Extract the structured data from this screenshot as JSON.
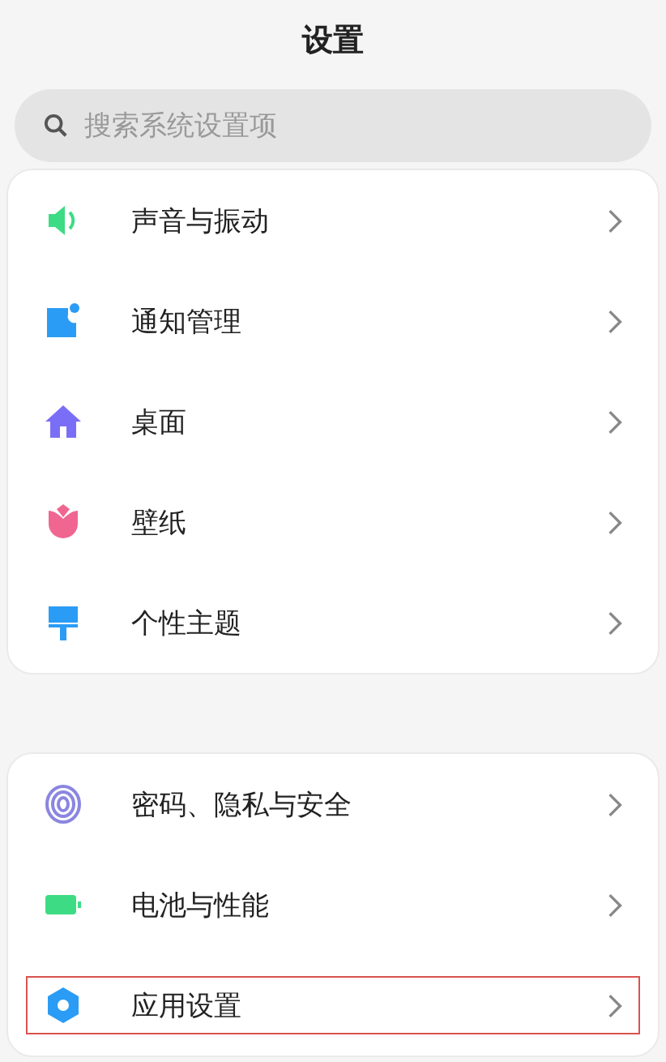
{
  "title": "设置",
  "search": {
    "placeholder": "搜索系统设置项"
  },
  "groups": [
    {
      "items": [
        {
          "label": "声音与振动",
          "highlighted": false
        },
        {
          "label": "通知管理",
          "highlighted": false
        },
        {
          "label": "桌面",
          "highlighted": false
        },
        {
          "label": "壁纸",
          "highlighted": false
        },
        {
          "label": "个性主题",
          "highlighted": false
        }
      ]
    },
    {
      "items": [
        {
          "label": "密码、隐私与安全",
          "highlighted": false
        },
        {
          "label": "电池与性能",
          "highlighted": false
        },
        {
          "label": "应用设置",
          "highlighted": true
        }
      ]
    }
  ]
}
